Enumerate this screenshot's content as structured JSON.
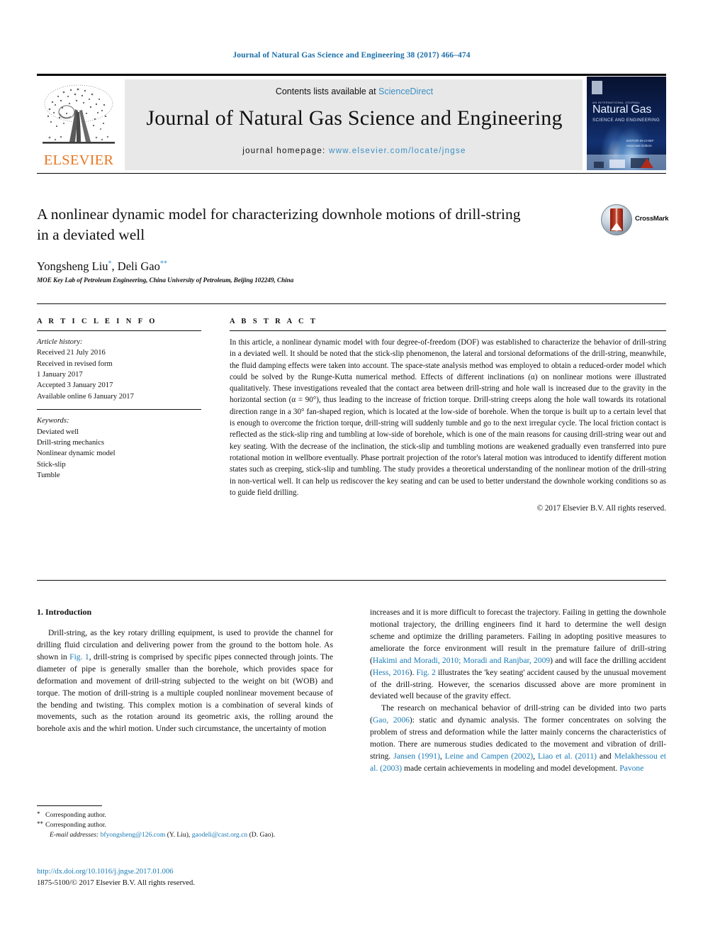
{
  "running_head": "Journal of Natural Gas Science and Engineering 38 (2017) 466–474",
  "masthead": {
    "contents_prefix": "Contents lists available at ",
    "sciencedirect": "ScienceDirect",
    "journal_title": "Journal of Natural Gas Science and Engineering",
    "homepage_prefix": "journal homepage: ",
    "homepage_url": "www.elsevier.com/locate/jngse",
    "publisher_logo_text": "ELSEVIER",
    "cover": {
      "small_top": "AN INTERNATIONAL JOURNAL",
      "brand": "Natural Gas",
      "subtitle": "SCIENCE AND ENGINEERING",
      "editors": "EDITOR-IN-CHIEF\nAssociate Editors"
    },
    "accent_link_color": "#3a8fc4"
  },
  "article": {
    "title": "A nonlinear dynamic model for characterizing downhole motions of drill-string in a deviated well",
    "crossmark_label": "CrossMark",
    "authors_html": "Yongsheng Liu<sup>*</sup>, Deli Gao<sup>**</sup>",
    "affiliation": "MOE Key Lab of Petroleum Engineering, China University of Petroleum, Beijing 102249, China"
  },
  "article_info": {
    "heading": "A R T I C L E   I N F O",
    "history_label": "Article history:",
    "history": [
      "Received 21 July 2016",
      "Received in revised form",
      "1 January 2017",
      "Accepted 3 January 2017",
      "Available online 6 January 2017"
    ],
    "keywords_label": "Keywords:",
    "keywords": [
      "Deviated well",
      "Drill-string mechanics",
      "Nonlinear dynamic model",
      "Stick-slip",
      "Tumble"
    ]
  },
  "abstract": {
    "heading": "A B S T R A C T",
    "text": "In this article, a nonlinear dynamic model with four degree-of-freedom (DOF) was established to characterize the behavior of drill-string in a deviated well. It should be noted that the stick-slip phenomenon, the lateral and torsional deformations of the drill-string, meanwhile, the fluid damping effects were taken into account. The space-state analysis method was employed to obtain a reduced-order model which could be solved by the Runge-Kutta numerical method. Effects of different inclinations (α) on nonlinear motions were illustrated qualitatively. These investigations revealed that the contact area between drill-string and hole wall is increased due to the gravity in the horizontal section (α = 90°), thus leading to the increase of friction torque. Drill-string creeps along the hole wall towards its rotational direction range in a 30° fan-shaped region, which is located at the low-side of borehole. When the torque is built up to a certain level that is enough to overcome the friction torque, drill-string will suddenly tumble and go to the next irregular cycle. The local friction contact is reflected as the stick-slip ring and tumbling at low-side of borehole, which is one of the main reasons for causing drill-string wear out and key seating. With the decrease of the inclination, the stick-slip and tumbling motions are weakened gradually even transferred into pure rotational motion in wellbore eventually. Phase portrait projection of the rotor's lateral motion was introduced to identify different motion states such as creeping, stick-slip and tumbling. The study provides a theoretical understanding of the nonlinear motion of the drill-string in non-vertical well. It can help us rediscover the key seating and can be used to better understand the downhole working conditions so as to guide field drilling.",
    "copyright": "© 2017 Elsevier B.V. All rights reserved."
  },
  "body": {
    "section_heading": "1. Introduction",
    "left_paragraph_1": "Drill-string, as the key rotary drilling equipment, is used to provide the channel for drilling fluid circulation and delivering power from the ground to the bottom hole. As shown in ",
    "left_fig1_link": "Fig. 1",
    "left_paragraph_1_cont": ", drill-string is comprised by specific pipes connected through joints. The diameter of pipe is generally smaller than the borehole, which provides space for deformation and movement of drill-string subjected to the weight on bit (WOB) and torque. The motion of drill-string is a multiple coupled nonlinear movement because of the bending and twisting. This complex motion is a combination of several kinds of movements, such as the rotation around its geometric axis, the rolling around the borehole axis and the whirl motion. Under such circumstance, the uncertainty of motion",
    "right_paragraph_1_a": "increases and it is more difficult to forecast the trajectory. Failing in getting the downhole motional trajectory, the drilling engineers find it hard to determine the well design scheme and optimize the drilling parameters. Failing in adopting positive measures to ameliorate the force environment will result in the premature failure of drill-string (",
    "right_cite_1": "Hakimi and Moradi, 2010; Moradi and Ranjbar, 2009",
    "right_paragraph_1_b": ") and will face the drilling accident (",
    "right_cite_2": "Hess, 2016",
    "right_paragraph_1_c": "). ",
    "right_cite_3": "Fig. 2",
    "right_paragraph_1_d": " illustrates the 'key seating' accident caused by the unusual movement of the drill-string. However, the scenarios discussed above are more prominent in deviated well because of the gravity effect.",
    "right_paragraph_2_a": "The research on mechanical behavior of drill-string can be divided into two parts (",
    "right_cite_4": "Gao, 2006",
    "right_paragraph_2_b": "): static and dynamic analysis. The former concentrates on solving the problem of stress and deformation while the latter mainly concerns the characteristics of motion. There are numerous studies dedicated to the movement and vibration of drill-string. ",
    "right_cite_5": "Jansen (1991)",
    "right_sep_1": ", ",
    "right_cite_6": "Leine and Campen (2002)",
    "right_sep_2": ", ",
    "right_cite_7": "Liao et al. (2011)",
    "right_sep_3": " and ",
    "right_cite_8": "Melakhessou et al. (2003)",
    "right_paragraph_2_c": " made certain achievements in modeling and model development. ",
    "right_cite_9": "Pavone",
    "link_color": "#1a7ab5"
  },
  "footnotes": {
    "corresponding_1": "Corresponding author.",
    "corresponding_2": "Corresponding author.",
    "email_label": "E-mail addresses:",
    "email_1": "bfyongsheng@126.com",
    "email_1_owner": "(Y. Liu)",
    "email_2": "gaodeli@cast.org.cn",
    "email_2_owner": "(D. Gao).",
    "marker_1": "*",
    "marker_2": "**"
  },
  "footer": {
    "doi": "http://dx.doi.org/10.1016/j.jngse.2017.01.006",
    "issn_line": "1875-5100/© 2017 Elsevier B.V. All rights reserved."
  }
}
